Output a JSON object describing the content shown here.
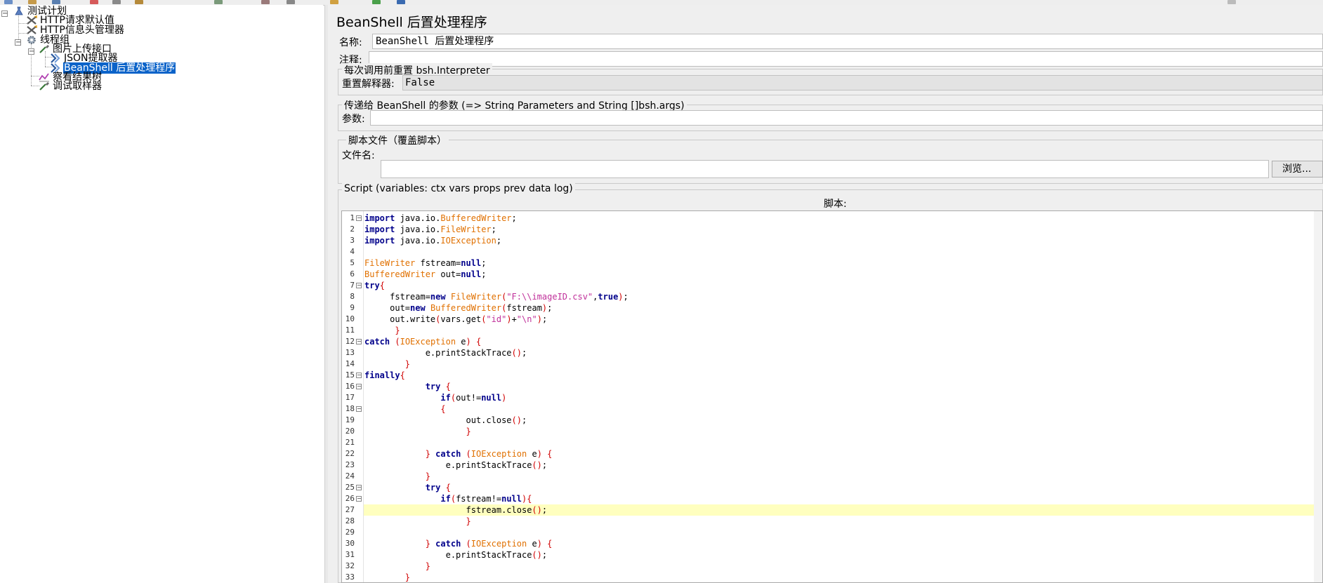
{
  "tree": {
    "items": [
      {
        "label": "测试计划",
        "icon": "test-plan-icon"
      },
      {
        "label": "HTTP请求默认值",
        "icon": "config-tools-icon"
      },
      {
        "label": "HTTP信息头管理器",
        "icon": "config-tools-icon"
      },
      {
        "label": "线程组",
        "icon": "thread-group-gear-icon"
      },
      {
        "label": "图片上传接口",
        "icon": "sampler-pipette-icon"
      },
      {
        "label": "JSON提取器",
        "icon": "post-processor-arrow-icon"
      },
      {
        "label": "BeanShell 后置处理程序",
        "icon": "post-processor-arrow-icon",
        "selected": true
      },
      {
        "label": "察看结果树",
        "icon": "listener-chart-icon"
      },
      {
        "label": "调试取样器",
        "icon": "sampler-pipette-icon"
      }
    ]
  },
  "panel": {
    "title": "BeanShell 后置处理程序",
    "name_label": "名称:",
    "name_value": "BeanShell 后置处理程序",
    "comment_label": "注释:",
    "comment_value": "",
    "reset_group_title": "每次调用前重置 bsh.Interpreter",
    "reset_label": "重置解释器:",
    "reset_value": "False",
    "params_group_title": "传递给 BeanShell 的参数 (=> String Parameters and String []bsh.args)",
    "params_label": "参数:",
    "params_value": "",
    "file_group_title": "脚本文件（覆盖脚本）",
    "file_label": "文件名:",
    "file_value": "",
    "browse_label": "浏览...",
    "script_group_title": "Script (variables: ctx vars props prev data log)",
    "script_header": "脚本:"
  },
  "code": {
    "highlighted_line": 27,
    "lines": [
      "import java.io.BufferedWriter;",
      "import java.io.FileWriter;",
      "import java.io.IOException;",
      "",
      "FileWriter fstream=null;",
      "BufferedWriter out=null;",
      "try{",
      "     fstream=new FileWriter(\"F:\\\\imageID.csv\",true);",
      "     out=new BufferedWriter(fstream);",
      "     out.write(vars.get(\"id\")+\"\\n\");",
      "      }",
      "catch (IOException e) {",
      "            e.printStackTrace();",
      "        }",
      "finally{",
      "            try {",
      "               if(out!=null)",
      "               {",
      "                    out.close();",
      "                    }",
      "",
      "            } catch (IOException e) {",
      "                e.printStackTrace();",
      "            }",
      "            try {",
      "               if(fstream!=null){",
      "                    fstream.close();",
      "                    }",
      "",
      "            } catch (IOException e) {",
      "                e.printStackTrace();",
      "            }",
      "        }"
    ]
  }
}
